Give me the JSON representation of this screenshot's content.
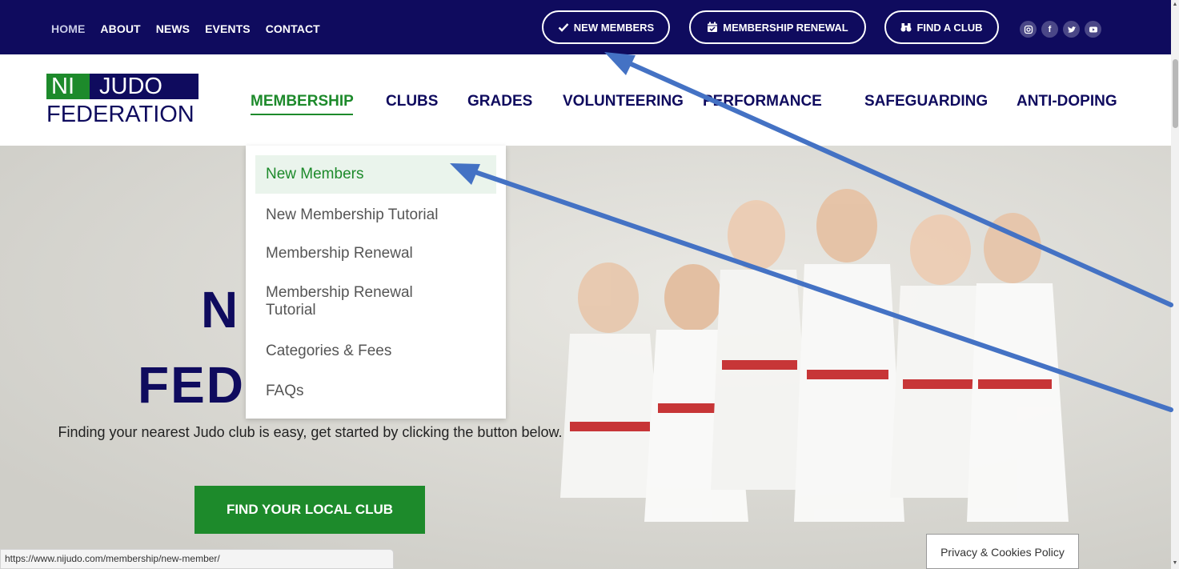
{
  "top_nav": [
    {
      "label": "HOME"
    },
    {
      "label": "ABOUT"
    },
    {
      "label": "NEWS"
    },
    {
      "label": "EVENTS"
    },
    {
      "label": "CONTACT"
    }
  ],
  "top_buttons": {
    "new_members": "NEW MEMBERS",
    "membership_renewal": "MEMBERSHIP RENEWAL",
    "find_a_club": "FIND A CLUB"
  },
  "social_icons": [
    "instagram-icon",
    "facebook-icon",
    "twitter-icon",
    "youtube-icon"
  ],
  "logo": {
    "part1": "NI",
    "part2": "JUDO",
    "part3": "FEDERATION"
  },
  "main_nav": {
    "membership": "MEMBERSHIP",
    "clubs": "CLUBS",
    "grades": "GRADES",
    "volunteering": "VOLUNTEERING",
    "performance": "PERFORMANCE",
    "safeguarding": "SAFEGUARDING",
    "anti_doping": "ANTI-DOPING"
  },
  "dropdown": {
    "new_members": "New Members",
    "new_membership_tutorial": "New Membership Tutorial",
    "membership_renewal": "Membership Renewal",
    "membership_renewal_tutorial_line1": "Membership Renewal",
    "membership_renewal_tutorial_line2": "Tutorial",
    "categories_fees": "Categories & Fees",
    "faqs": "FAQs"
  },
  "hero": {
    "title_line1": "N",
    "title_line2": "FED",
    "subtitle": "Finding your nearest Judo club is easy, get started by clicking the button below.",
    "cta": "FIND YOUR LOCAL CLUB"
  },
  "status_url": "https://www.nijudo.com/membership/new-member/",
  "cookie_policy": "Privacy & Cookies Policy",
  "colors": {
    "navy": "#0f0b5e",
    "green": "#1d8a2b",
    "annotation_arrow": "#4472c4"
  }
}
